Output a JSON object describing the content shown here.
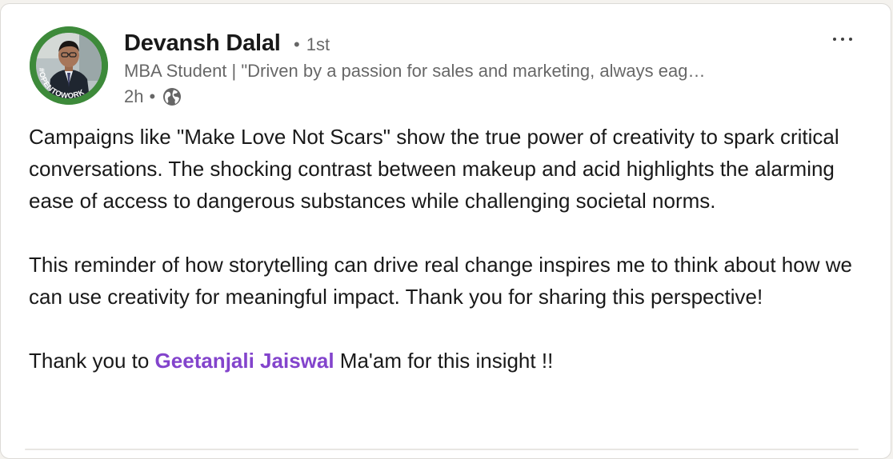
{
  "post": {
    "author": {
      "name": "Devansh Dalal",
      "degree_separator": "•",
      "degree": "1st",
      "headline": "MBA Student | \"Driven by a passion for sales and marketing, always eag…",
      "avatar_badge": "#OPENTOWORK",
      "avatar_badge_color": "#3d8a3a"
    },
    "meta": {
      "time": "2h",
      "separator": "•",
      "visibility_icon": "globe-icon"
    },
    "more_icon": "ellipsis-icon",
    "paragraphs": [
      "Campaigns like \"Make Love Not Scars\" show the true power of creativity to spark critical conversations. The shocking contrast between makeup and acid highlights the alarming ease of access to dangerous substances while challenging societal norms.",
      "This reminder of how storytelling can drive real change inspires me to think about how we can use creativity for meaningful impact. Thank you for sharing this perspective!"
    ],
    "closing": {
      "before": "Thank you to ",
      "mention": "Geetanjali Jaiswal",
      "after": " Ma'am for this insight !!"
    },
    "mention_color": "#8344cc"
  }
}
